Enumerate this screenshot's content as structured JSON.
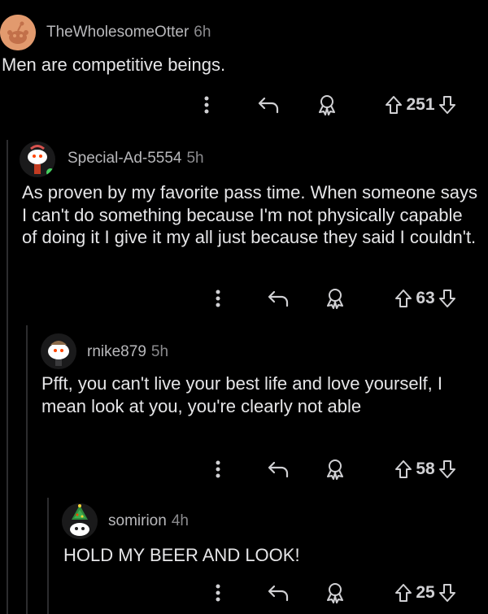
{
  "comments": [
    {
      "username": "TheWholesomeOtter",
      "age": "6h",
      "body": "Men are competitive beings.",
      "score": "251",
      "avatar_icon": "snoo-orange-avatar-icon"
    },
    {
      "username": "Special-Ad-5554",
      "age": "5h",
      "body": "As proven by my favorite pass time. When someone says I can't do something because I'm not physically capable of doing it I give it my all just because they said I couldn't.",
      "score": "63",
      "avatar_icon": "snoo-avatar-icon"
    },
    {
      "username": "rnike879",
      "age": "5h",
      "body": "Pfft, you can't live your best life and love yourself, I mean look at you, you're clearly not able",
      "score": "58",
      "avatar_icon": "snoo-avatar-icon"
    },
    {
      "username": "somirion",
      "age": "4h",
      "body": "HOLD MY BEER AND LOOK!",
      "score": "25",
      "avatar_icon": "snoo-christmas-tree-avatar-icon"
    }
  ],
  "icons": {
    "more": "more-options-icon",
    "reply": "reply-icon",
    "award": "award-icon",
    "upvote": "upvote-arrow-icon",
    "downvote": "downvote-arrow-icon"
  },
  "colors": {
    "background": "#000000",
    "online_dot": "#46d160",
    "orange_avatar": "#e29a6e"
  }
}
